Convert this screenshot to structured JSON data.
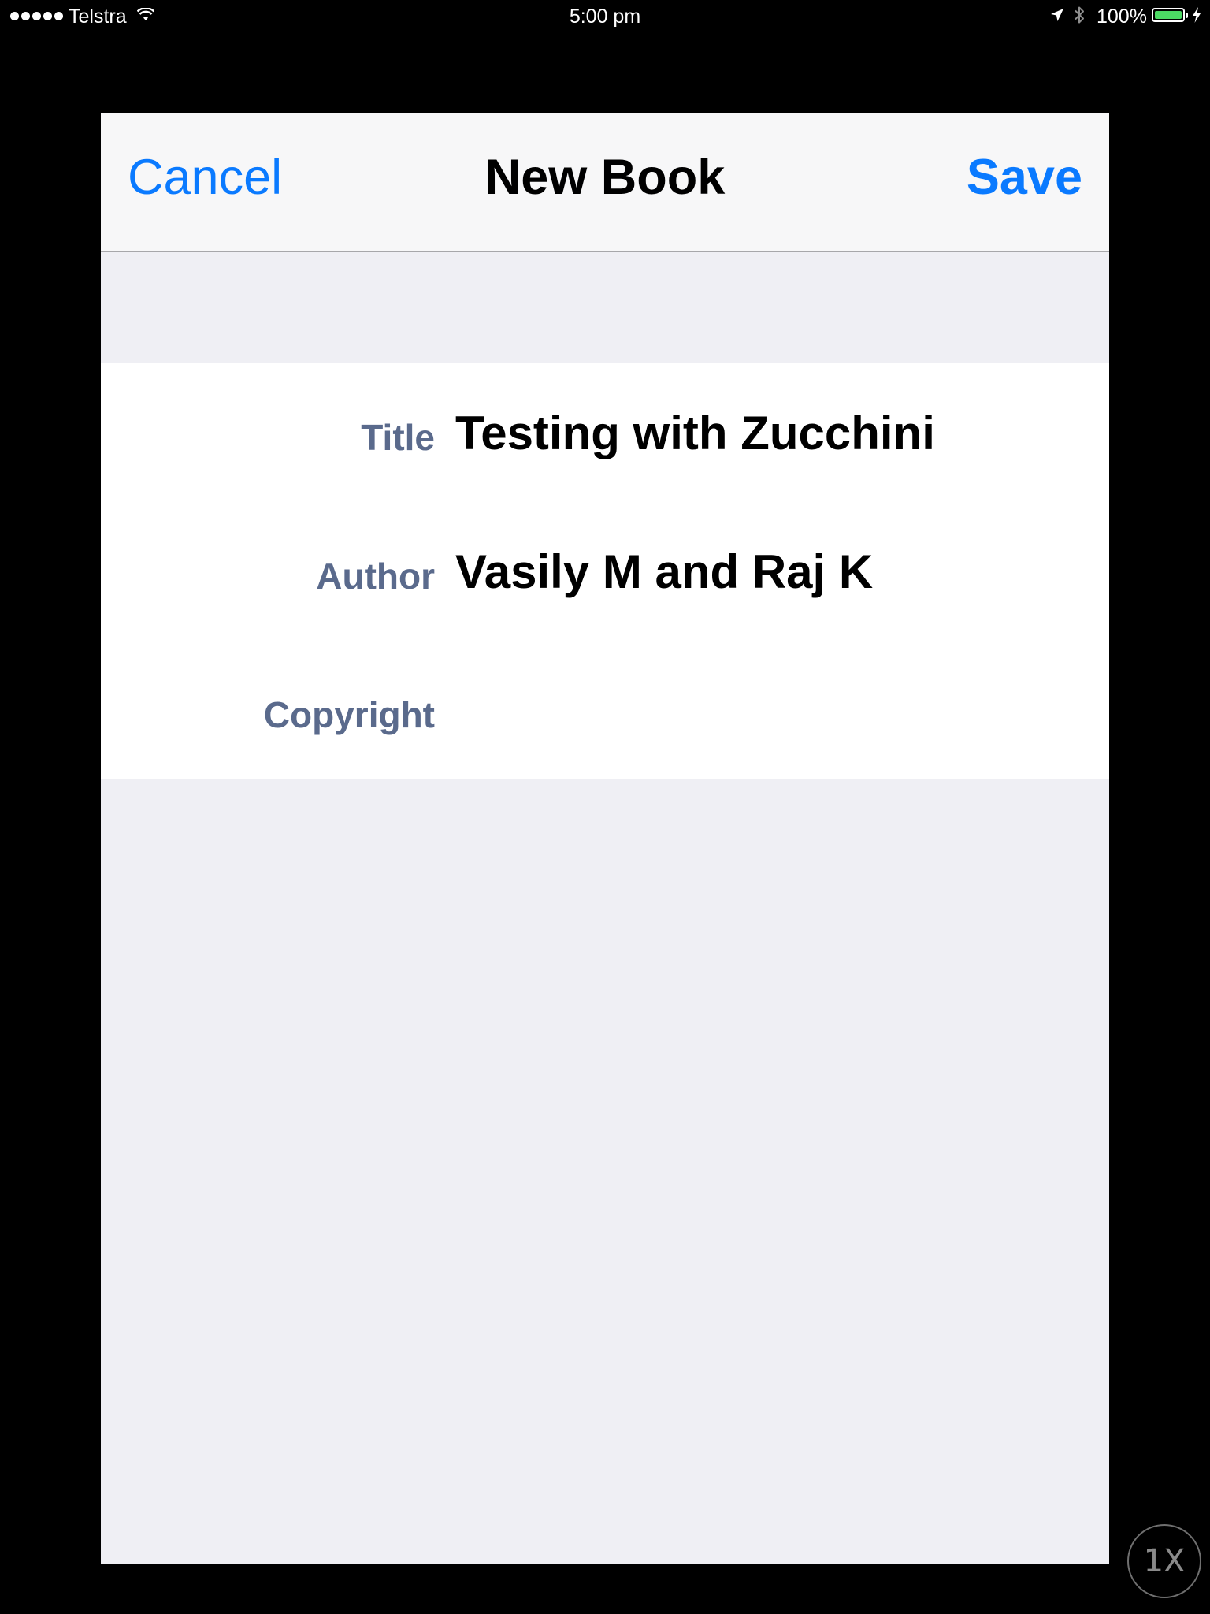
{
  "status_bar": {
    "carrier": "Telstra",
    "time": "5:00 pm",
    "battery_percent": "100%",
    "icons": [
      "signal-dots-icon",
      "wifi-icon",
      "location-arrow-icon",
      "bluetooth-icon",
      "battery-icon",
      "charging-bolt-icon"
    ],
    "battery_level": 1.0
  },
  "nav": {
    "cancel_label": "Cancel",
    "title": "New Book",
    "save_label": "Save"
  },
  "form": {
    "title_label": "Title",
    "title_value": "Testing with Zucchini",
    "author_label": "Author",
    "author_value": "Vasily M and Raj K",
    "copyright_label": "Copyright",
    "copyright_value": ""
  },
  "zoom_indicator": "1X",
  "colors": {
    "accent": "#0a7aff",
    "label": "#5a6a8c",
    "background": "#efeff4",
    "battery": "#4cd964"
  }
}
